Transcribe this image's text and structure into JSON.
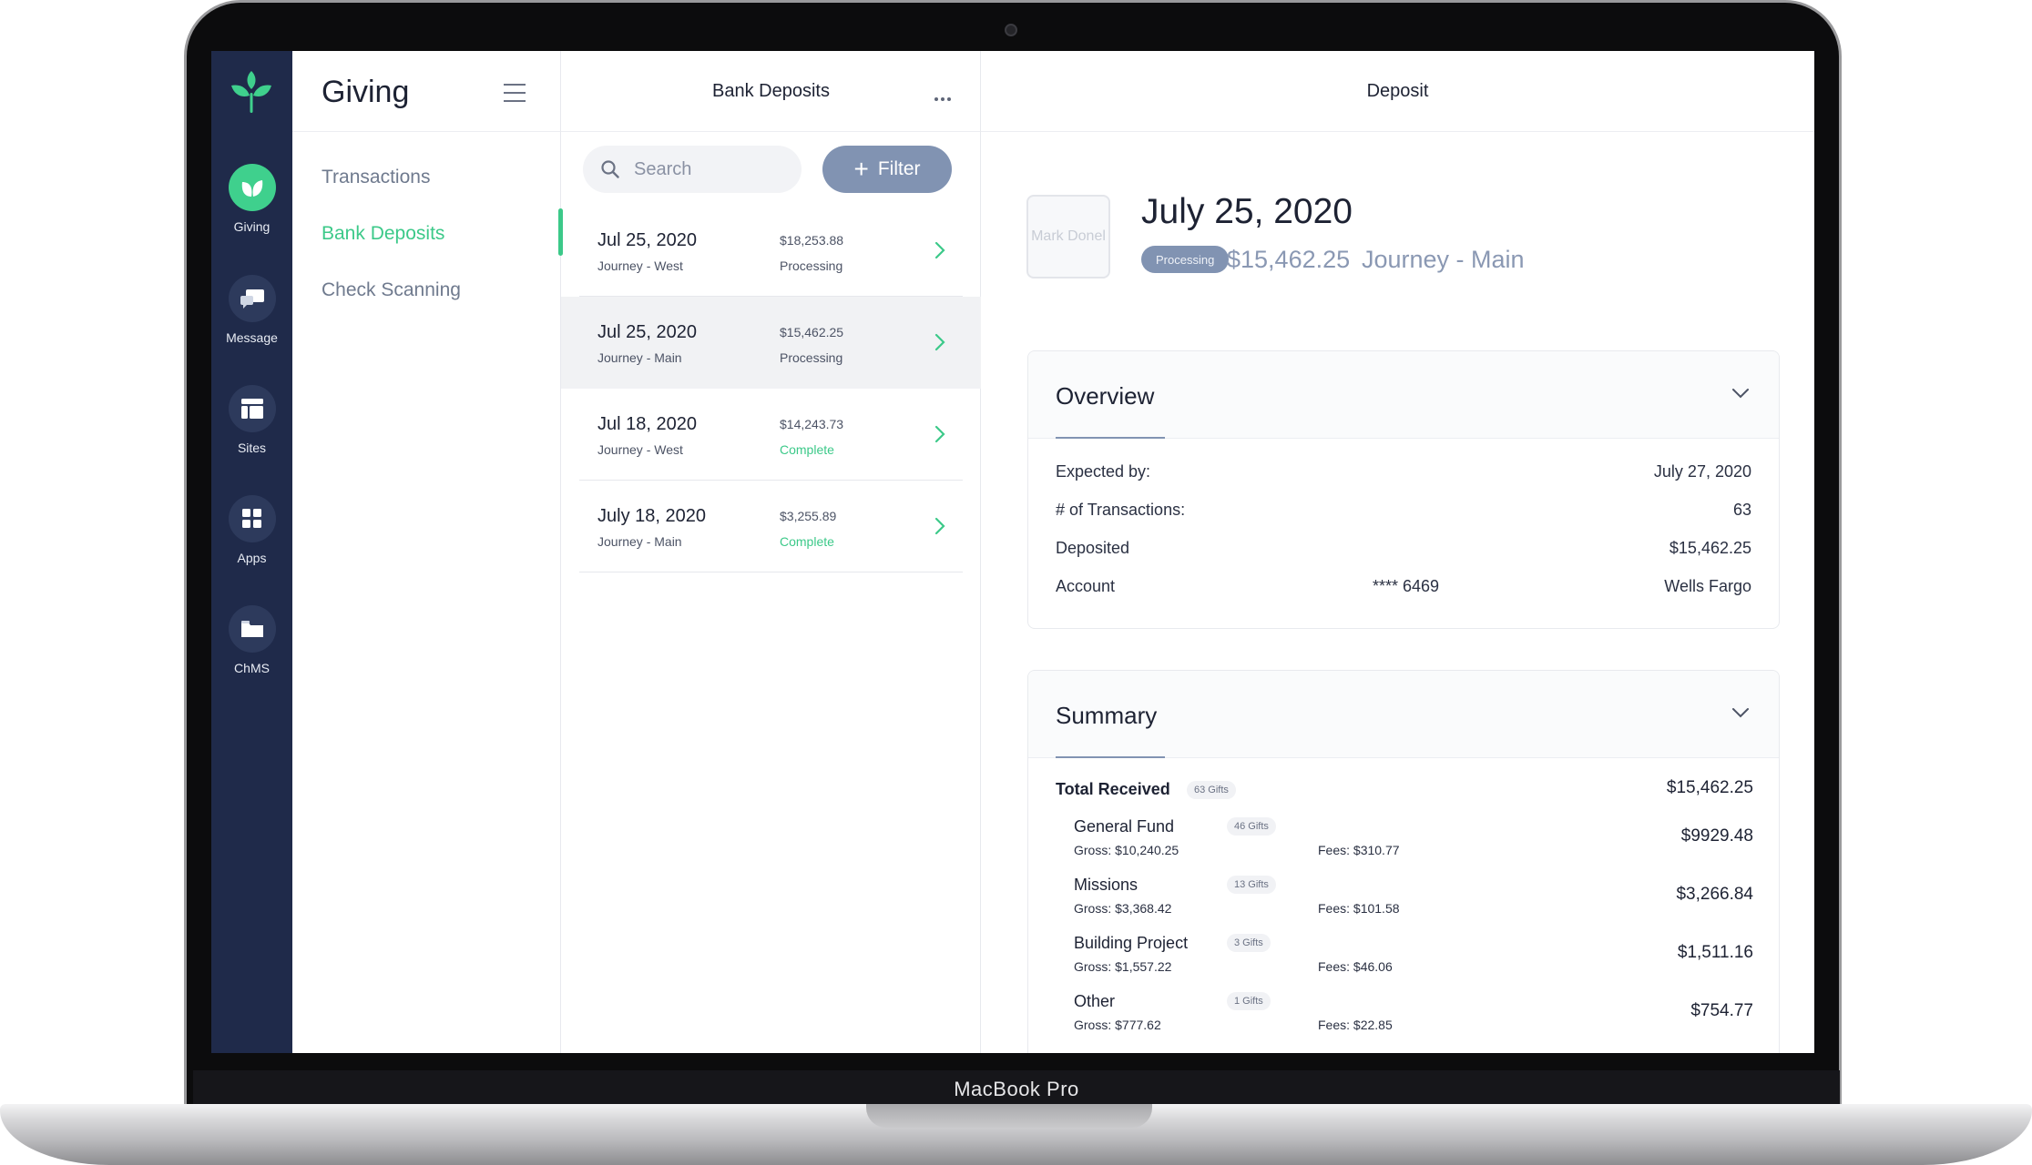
{
  "device": {
    "label": "MacBook Pro"
  },
  "rail": {
    "items": [
      {
        "label": "Giving",
        "icon": "leaf-icon",
        "active": true
      },
      {
        "label": "Message",
        "icon": "chat-icon"
      },
      {
        "label": "Sites",
        "icon": "layout-icon"
      },
      {
        "label": "Apps",
        "icon": "grid-icon"
      },
      {
        "label": "ChMS",
        "icon": "folder-icon"
      }
    ]
  },
  "nav": {
    "title": "Giving",
    "links": [
      {
        "label": "Transactions"
      },
      {
        "label": "Bank Deposits",
        "active": true
      },
      {
        "label": "Check Scanning"
      }
    ]
  },
  "list": {
    "title": "Bank Deposits",
    "search_placeholder": "Search",
    "filter_label": "Filter",
    "deposits": [
      {
        "date": "Jul 25, 2020",
        "site": "Journey - West",
        "amount": "$18,253.88",
        "status": "Processing"
      },
      {
        "date": "Jul 25, 2020",
        "site": "Journey - Main",
        "amount": "$15,462.25",
        "status": "Processing",
        "selected": true
      },
      {
        "date": "Jul 18, 2020",
        "site": "Journey - West",
        "amount": "$14,243.73",
        "status": "Complete"
      },
      {
        "date": "July 18, 2020",
        "site": "Journey - Main",
        "amount": "$3,255.89",
        "status": "Complete"
      }
    ]
  },
  "detail": {
    "title": "Deposit",
    "stamp": "Mark Donel",
    "date": "July 25, 2020",
    "status": "Processing",
    "amount": "$15,462.25",
    "site": "Journey - Main",
    "overview": {
      "title": "Overview",
      "expected_label": "Expected by:",
      "expected_value": "July 27, 2020",
      "transactions_label": "# of Transactions:",
      "transactions_value": "63",
      "deposited_label": "Deposited",
      "deposited_value": "$15,462.25",
      "account_label": "Account",
      "account_number": "**** 6469",
      "account_bank": "Wells Fargo"
    },
    "summary": {
      "title": "Summary",
      "total_label": "Total Received",
      "total_gifts": "63 Gifts",
      "total_value": "$15,462.25",
      "funds": [
        {
          "name": "General Fund",
          "gifts": "46 Gifts",
          "gross": "Gross: $10,240.25",
          "fees": "Fees: $310.77",
          "net": "$9929.48"
        },
        {
          "name": "Missions",
          "gifts": "13 Gifts",
          "gross": "Gross: $3,368.42",
          "fees": "Fees: $101.58",
          "net": "$3,266.84"
        },
        {
          "name": "Building Project",
          "gifts": "3 Gifts",
          "gross": "Gross: $1,557.22",
          "fees": "Fees: $46.06",
          "net": "$1,511.16"
        },
        {
          "name": "Other",
          "gifts": "1 Gifts",
          "gross": "Gross: $777.62",
          "fees": "Fees: $22.85",
          "net": "$754.77"
        }
      ]
    }
  },
  "colors": {
    "rail_bg": "#1f2a4a",
    "accent_green": "#3cc989",
    "accent_slate": "#8193b2"
  }
}
